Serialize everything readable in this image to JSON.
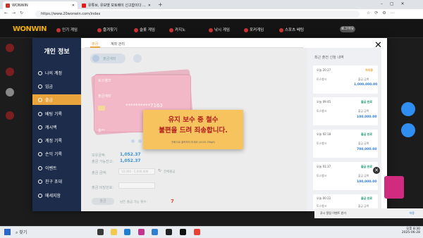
{
  "browser": {
    "tabs": [
      {
        "label": "WONWIN",
        "favicon_color": "#c0392b"
      },
      {
        "label": "유튜브, 유보벳 모토배이 신고합이다 ...",
        "favicon_color": "#e21d1d"
      }
    ],
    "url": "https://www.20wonwin.com/index"
  },
  "site": {
    "logo": "WONWIN",
    "nav": [
      "인기 게임",
      "즐겨찾기",
      "슬롯 게임",
      "카지노",
      "낚시 게임",
      "포커게임",
      "스포츠 베팅"
    ],
    "header_button": "로그아웃"
  },
  "modal": {
    "sidebar_title": "개인 정보",
    "sidebar": [
      {
        "label": "나의 계정",
        "icon": "user-icon"
      },
      {
        "label": "입금",
        "icon": "deposit-icon"
      },
      {
        "label": "출금",
        "icon": "withdraw-icon",
        "active": true
      },
      {
        "label": "베팅 기록",
        "icon": "bet-icon"
      },
      {
        "label": "캐시백",
        "icon": "cashback-icon"
      },
      {
        "label": "계정 기록",
        "icon": "account-icon"
      },
      {
        "label": "손익 기록",
        "icon": "profit-icon"
      },
      {
        "label": "이벤트",
        "icon": "event-icon"
      },
      {
        "label": "친구 초대",
        "icon": "friend-icon"
      },
      {
        "label": "메세지함",
        "icon": "message-icon"
      }
    ],
    "tabs": [
      "출금",
      "계좌 관리"
    ],
    "withdraw_btn": "출금계좌",
    "card": {
      "bank": "토스뱅크",
      "label": "출금계좌",
      "number": "**********7163",
      "holder": "홍**"
    },
    "notice": {
      "line1": "유지 보수 중 철수",
      "line2": "불편을 드려 죄송합니다.",
      "sub": "전화으로 클릭하지 마세요 (4045-78tg8)"
    },
    "fields": {
      "available_label": "보유금액:",
      "available_value": "1,052.37",
      "withdrawable_label": "출금 가능잔고:",
      "withdrawable_value": "1,052.37",
      "amount_label": "출금 금액:",
      "amount_placeholder": "10,000 - 5,000,000",
      "all_label": "전체출금",
      "password_label": "출금 비밀번호:",
      "submit": "출금",
      "count_label": "남은 출금 가능 횟수:",
      "count_value": "7"
    },
    "history_title": "최근 출전 신청 내역",
    "history": [
      {
        "time": "오늘 20:27",
        "status": "처리중",
        "bank": "토스뱅크",
        "amount_label": "출금 금액",
        "amount": "1,000,000.00"
      },
      {
        "time": "오늘 09:45",
        "status": "출금 완료",
        "bank": "토스뱅크",
        "amount_label": "출금 금액",
        "amount": "100,000.00"
      },
      {
        "time": "오늘 02:18",
        "status": "출금 완료",
        "bank": "토스뱅크",
        "amount_label": "출금 금액",
        "amount": "700,000.00"
      },
      {
        "time": "오늘 01:37",
        "status": "출금 완료",
        "bank": "토스뱅크",
        "amount_label": "출금 금액",
        "amount": "100,000.00"
      },
      {
        "time": "오늘 00:22",
        "status": "출금 완료",
        "bank": "토스뱅크",
        "amount_label": "출금 금액",
        "amount": ""
      }
    ]
  },
  "notification": {
    "text": "푸시 알림 이벤트 받기",
    "action": "허용"
  },
  "taskbar": {
    "search": "찾기",
    "time": "오후 8:30",
    "date": "2025-06-28"
  }
}
